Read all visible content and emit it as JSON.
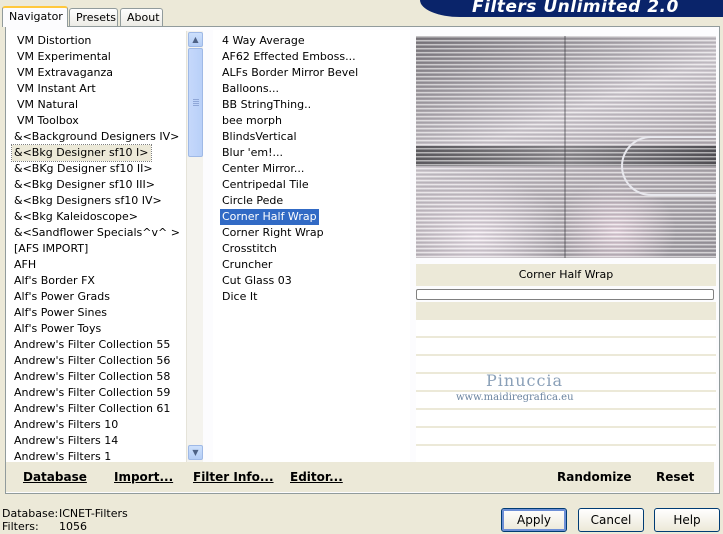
{
  "tabs": [
    {
      "label": "Navigator",
      "active": true
    },
    {
      "label": "Presets",
      "active": false
    },
    {
      "label": "About",
      "active": false
    }
  ],
  "title": "Filters Unlimited 2.0",
  "categories": [
    "VM Distortion",
    "VM Experimental",
    "VM Extravaganza",
    "VM Instant Art",
    "VM Natural",
    "VM Toolbox",
    "&<Background Designers IV>",
    "&<Bkg Designer sf10 I>",
    "&<BKg Designer sf10 II>",
    "&<Bkg Designer sf10 III>",
    "&<Bkg Designers sf10 IV>",
    "&<Bkg Kaleidoscope>",
    "&<Sandflower Specials^v^ >",
    "[AFS IMPORT]",
    "AFH",
    "Alf's Border FX",
    "Alf's Power Grads",
    "Alf's Power Sines",
    "Alf's Power Toys",
    "Andrew's Filter Collection 55",
    "Andrew's Filter Collection 56",
    "Andrew's Filter Collection 58",
    "Andrew's Filter Collection 59",
    "Andrew's Filter Collection 61",
    "Andrew's Filters 10",
    "Andrew's Filters 14",
    "Andrew's Filters 1"
  ],
  "selected_category_index": 7,
  "filters": [
    "4 Way Average",
    "AF62 Effected Emboss...",
    "ALFs Border Mirror Bevel",
    "Balloons...",
    "BB StringThing..",
    "bee morph",
    "BlindsVertical",
    "Blur 'em!...",
    "Center Mirror...",
    "Centripedal Tile",
    "Circle Pede",
    "Corner Half Wrap",
    "Corner Right Wrap",
    "Crosstitch",
    "Cruncher",
    "Cut Glass 03",
    "Dice It"
  ],
  "selected_filter_index": 11,
  "preview_label": "Corner Half Wrap",
  "watermark": {
    "name": "Pinuccia",
    "url": "www.maidiregrafica.eu"
  },
  "bottom_left": {
    "database": "Database",
    "import": "Import...",
    "filter_info": "Filter Info...",
    "editor": "Editor..."
  },
  "bottom_right": {
    "randomize": "Randomize",
    "reset": "Reset"
  },
  "status": {
    "database_label": "Database:",
    "database_value": "ICNET-Filters",
    "filters_label": "Filters:",
    "filters_value": "1056"
  },
  "buttons": {
    "apply": "Apply",
    "cancel": "Cancel",
    "help": "Help"
  }
}
